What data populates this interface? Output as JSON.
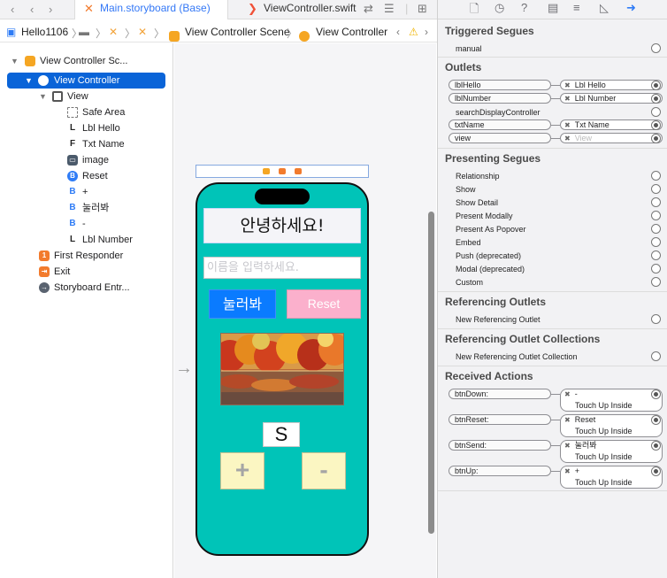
{
  "tabbar": {
    "back_icon": "chevron-left",
    "forward_icon": "chevron-right",
    "active_tab": "Main.storyboard (Base)",
    "inactive_tab": "ViewController.swift"
  },
  "breadcrumb": {
    "project": "Hello1106",
    "scene": "View Controller Scene",
    "controller": "View Controller"
  },
  "navigator": {
    "items": [
      {
        "label": "View Controller Sc...",
        "icon": "scene-icon"
      },
      {
        "label": "View Controller",
        "icon": "view-controller-icon"
      },
      {
        "label": "View",
        "icon": "view-icon"
      },
      {
        "label": "Safe Area",
        "icon": "safe-area-icon"
      },
      {
        "label": "Lbl Hello",
        "icon": "label-icon",
        "letter": "L"
      },
      {
        "label": "Txt Name",
        "icon": "textfield-icon",
        "letter": "F"
      },
      {
        "label": "image",
        "icon": "imageview-icon"
      },
      {
        "label": "Reset",
        "icon": "button-icon",
        "letter": "B"
      },
      {
        "label": "+",
        "icon": "button-icon",
        "letter": "B"
      },
      {
        "label": "눌러봐",
        "icon": "button-icon",
        "letter": "B"
      },
      {
        "label": "-",
        "icon": "button-icon",
        "letter": "B"
      },
      {
        "label": "Lbl Number",
        "icon": "label-icon",
        "letter": "L"
      },
      {
        "label": "First Responder",
        "icon": "first-responder-icon"
      },
      {
        "label": "Exit",
        "icon": "exit-icon"
      },
      {
        "label": "Storyboard Entr...",
        "icon": "entry-point-icon"
      }
    ]
  },
  "phone": {
    "hello_text": "안녕하세요!",
    "placeholder": "이름을 입력하세요.",
    "send_label": "눌러봐",
    "reset_label": "Reset",
    "number_text": "S",
    "plus_label": "+",
    "minus_label": "-"
  },
  "inspector": {
    "triggered_segues": {
      "title": "Triggered Segues",
      "rows": [
        "manual"
      ]
    },
    "outlets": {
      "title": "Outlets",
      "rows": [
        {
          "name": "lblHello",
          "target": "Lbl Hello",
          "connected": true
        },
        {
          "name": "lblNumber",
          "target": "Lbl Number",
          "connected": true
        },
        {
          "name": "searchDisplayController",
          "target": "",
          "connected": false
        },
        {
          "name": "txtName",
          "target": "Txt Name",
          "connected": true
        },
        {
          "name": "view",
          "target": "View",
          "connected": true,
          "dimmed": true
        }
      ]
    },
    "presenting_segues": {
      "title": "Presenting Segues",
      "rows": [
        "Relationship",
        "Show",
        "Show Detail",
        "Present Modally",
        "Present As Popover",
        "Embed",
        "Push (deprecated)",
        "Modal (deprecated)",
        "Custom"
      ]
    },
    "referencing_outlets": {
      "title": "Referencing Outlets",
      "rows": [
        "New Referencing Outlet"
      ]
    },
    "referencing_collections": {
      "title": "Referencing Outlet Collections",
      "rows": [
        "New Referencing Outlet Collection"
      ]
    },
    "received_actions": {
      "title": "Received Actions",
      "rows": [
        {
          "name": "btnDown:",
          "target": "-",
          "event": "Touch Up Inside"
        },
        {
          "name": "btnReset:",
          "target": "Reset",
          "event": "Touch Up Inside"
        },
        {
          "name": "btnSend:",
          "target": "눌러봐",
          "event": "Touch Up Inside"
        },
        {
          "name": "btnUp:",
          "target": "+",
          "event": "Touch Up Inside"
        }
      ]
    }
  },
  "colors": {
    "accent": "#0a64d8",
    "phone_background": "#00c4b8",
    "reset_button": "#fbb0cc",
    "send_button": "#0a7bff",
    "stepper_buttons": "#fbf6c2"
  }
}
